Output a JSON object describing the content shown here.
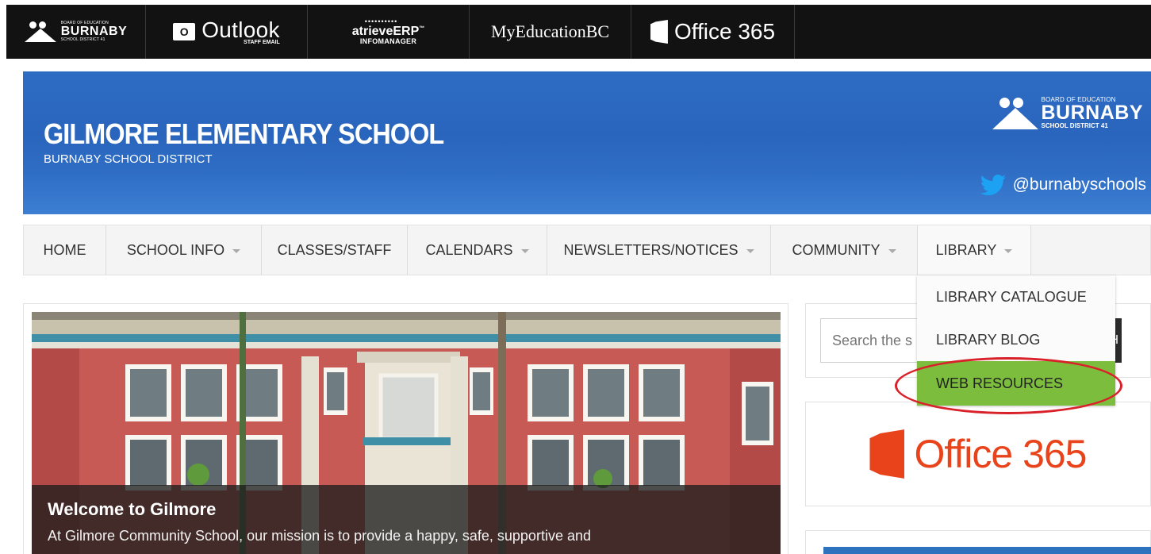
{
  "topbar": {
    "burnaby": {
      "small": "BOARD OF EDUCATION",
      "name": "BURNABY",
      "district": "SCHOOL DISTRICT 41"
    },
    "outlook": {
      "letter": "O",
      "name": "Outlook",
      "sub": "STAFF EMAIL"
    },
    "atrieve": {
      "dots": "••••••••••",
      "name": "atrieveERP",
      "tm": "™",
      "sub": "INFOMANAGER"
    },
    "myed": {
      "name": "MyEducationBC"
    },
    "office365": {
      "name": "Office 365"
    }
  },
  "banner": {
    "title": "GILMORE ELEMENTARY SCHOOL",
    "subtitle": "BURNABY SCHOOL DISTRICT",
    "logo": {
      "small": "BOARD OF EDUCATION",
      "name": "BURNABY",
      "district": "SCHOOL DISTRICT 41"
    },
    "twitter": {
      "handle": "@burnabyschools",
      "icon": "twitter-bird-icon"
    }
  },
  "nav": {
    "items": [
      {
        "label": "HOME",
        "has_caret": false
      },
      {
        "label": "SCHOOL INFO",
        "has_caret": true
      },
      {
        "label": "CLASSES/STAFF",
        "has_caret": false
      },
      {
        "label": "CALENDARS",
        "has_caret": true
      },
      {
        "label": "NEWSLETTERS/NOTICES",
        "has_caret": true
      },
      {
        "label": "COMMUNITY",
        "has_caret": true
      },
      {
        "label": "LIBRARY",
        "has_caret": true
      }
    ]
  },
  "library_dropdown": {
    "items": [
      {
        "label": "LIBRARY CATALOGUE",
        "active": false
      },
      {
        "label": "LIBRARY BLOG",
        "active": false
      },
      {
        "label": "WEB RESOURCES",
        "active": true
      }
    ]
  },
  "hero": {
    "title": "Welcome to Gilmore",
    "text": "At Gilmore Community School, our mission is to provide a happy, safe, supportive and"
  },
  "sidebar": {
    "search": {
      "placeholder": "Search the s",
      "button": "CH"
    },
    "office365": {
      "label": "Office 365"
    }
  },
  "colors": {
    "topbar": "#121212",
    "banner": "#2a65bd",
    "active_menu": "#7cbd3e",
    "annotation": "#d9212a",
    "office_red": "#e8431b"
  }
}
